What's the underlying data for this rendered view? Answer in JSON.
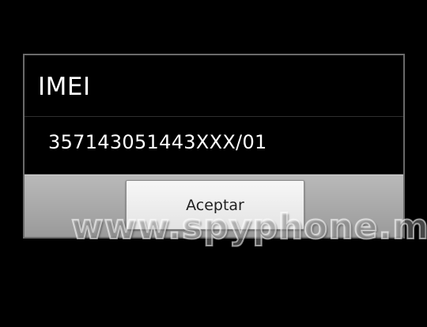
{
  "dialog": {
    "title": "IMEI",
    "message": "357143051443XXX/01",
    "ok_button_label": "Aceptar"
  },
  "watermark": {
    "text": "www.spyphone.me"
  }
}
